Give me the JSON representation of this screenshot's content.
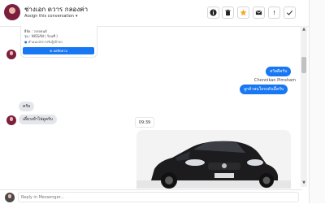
{
  "header": {
    "contact_name": "ช่างเอก ดวาร กลองค่า",
    "assign_label": "Assign this conversation",
    "assign_caret": "▾"
  },
  "toolbar": {
    "info_icon": "info-icon",
    "delete_icon": "trash-icon",
    "star_icon": "star-icon",
    "mail_icon": "mail-icon",
    "alert_label": "!",
    "done_icon": "check-icon",
    "star_color": "#f5a623"
  },
  "card": {
    "line1": "ยี่ห้อ : วงรถยนต์",
    "line2": "รุ่น : NISSAN ( ร้อนซึ่ )",
    "link": "ค่ำแนะนำการรับรู้เข้ารถ",
    "button_label": "⊕ ผลติดตาม"
  },
  "messages": {
    "out1": "สวัสดีครับ",
    "sender_name": "Chonnikan Pimsham",
    "out2": "ลูกค้าสนใจรถคันนี้ครับ",
    "in1": "ครับ",
    "in2": "เดี๋ยวเข้าไปดูครับ",
    "time": "09:39"
  },
  "composer": {
    "placeholder": "Reply in Messenger..."
  },
  "scrollbar": {
    "up": "▲",
    "down": "▼"
  },
  "colors": {
    "accent": "#1877f2",
    "incoming": "#e4e6eb"
  }
}
